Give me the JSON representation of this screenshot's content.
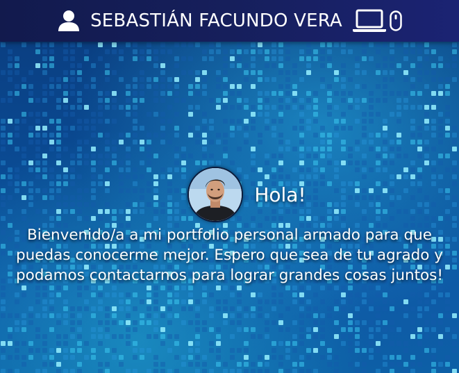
{
  "header": {
    "title": "SEBASTIÁN FACUNDO VERA",
    "left_icon": "user-icon",
    "right_icons": [
      "laptop-icon",
      "mouse-icon"
    ]
  },
  "intro": {
    "greeting": "Hola!",
    "welcome_lines": [
      "Bienvenido/a a mi portfolio personal armado para que",
      "puedas conocerme mejor. Espero que sea de tu agrado y",
      "podamos contactarnos para lograr grandes cosas juntos!"
    ]
  },
  "colors": {
    "header_bg": "#161f5c",
    "text": "#ffffff",
    "background_blue": "#0a4b94",
    "tile_cyan": "#29c6e8"
  }
}
